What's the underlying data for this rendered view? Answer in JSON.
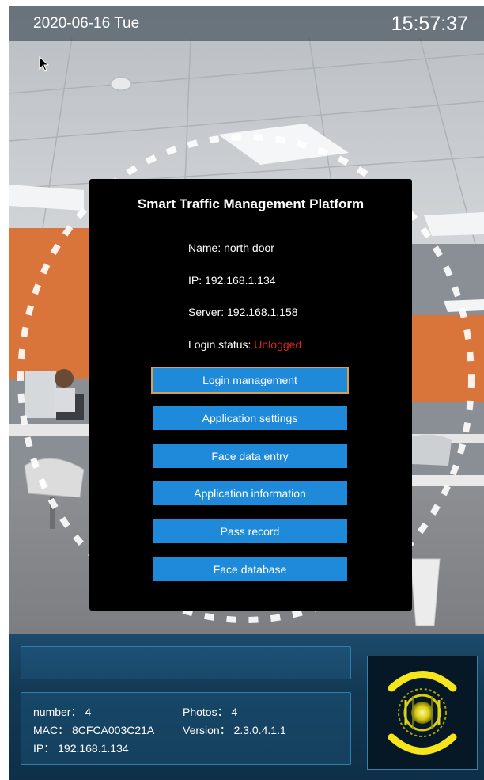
{
  "status_bar": {
    "date": "2020-06-16 Tue",
    "time": "15:57:37"
  },
  "dialog": {
    "title": "Smart Traffic Management Platform",
    "name_line": "Name: north door",
    "ip_line": "IP: 192.168.1.134",
    "server_line": "Server: 192.168.1.158",
    "login_status_label": "Login status: ",
    "login_status_value": "Unlogged",
    "buttons": {
      "login": "Login management",
      "settings": "Application settings",
      "face_entry": "Face data entry",
      "app_info": "Application information",
      "pass_record": "Pass record",
      "face_db": "Face database"
    }
  },
  "device_info": {
    "number": "number： 4",
    "photos": "Photos： 4",
    "mac": "MAC： 8CFCA003C21A",
    "version": "Version： 2.3.0.4.1.1",
    "ip": "IP： 192.168.1.134"
  },
  "colors": {
    "button_blue": "#1f8ad9",
    "focus_outline": "#d7a14a",
    "unlogged_red": "#e02020",
    "panel_border": "#2f7fae",
    "indicator_yellow": "#f5e51a"
  },
  "icons": {
    "cursor": "mouse-pointer-icon",
    "face_indicator": "face-scan-indicator-icon"
  }
}
